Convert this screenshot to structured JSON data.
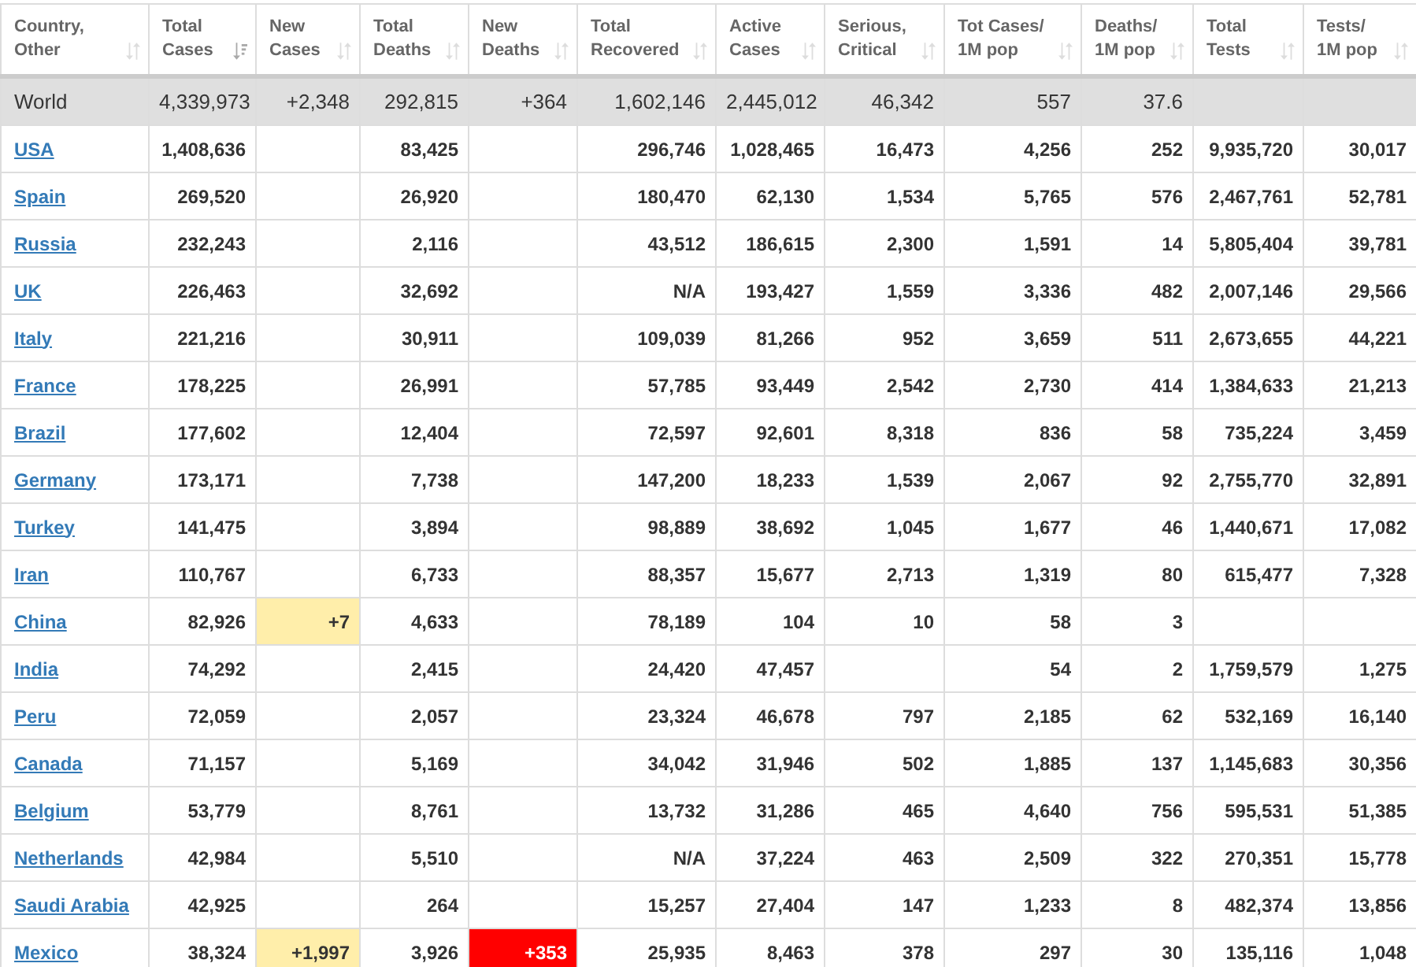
{
  "table": {
    "columns": [
      {
        "label": "Country, Other",
        "kind": "country",
        "sorted": false
      },
      {
        "label": "Total Cases",
        "kind": "number",
        "sorted": true
      },
      {
        "label": "New Cases",
        "kind": "new_cases",
        "sorted": false
      },
      {
        "label": "Total Deaths",
        "kind": "number",
        "sorted": false
      },
      {
        "label": "New Deaths",
        "kind": "new_deaths",
        "sorted": false
      },
      {
        "label": "Total Recovered",
        "kind": "number",
        "sorted": false
      },
      {
        "label": "Active Cases",
        "kind": "number",
        "sorted": false
      },
      {
        "label": "Serious, Critical",
        "kind": "number",
        "sorted": false
      },
      {
        "label": "Tot Cases/ 1M pop",
        "kind": "number",
        "sorted": false
      },
      {
        "label": "Deaths/ 1M pop",
        "kind": "number",
        "sorted": false
      },
      {
        "label": "Total Tests",
        "kind": "number",
        "sorted": false
      },
      {
        "label": "Tests/ 1M pop",
        "kind": "number",
        "sorted": false
      }
    ],
    "rows": [
      {
        "kind": "total",
        "cells": [
          "World",
          "4,339,973",
          "+2,348",
          "292,815",
          "+364",
          "1,602,146",
          "2,445,012",
          "46,342",
          "557",
          "37.6",
          null,
          null
        ]
      },
      {
        "kind": "country",
        "cells": [
          "USA",
          "1,408,636",
          null,
          "83,425",
          null,
          "296,746",
          "1,028,465",
          "16,473",
          "4,256",
          "252",
          "9,935,720",
          "30,017"
        ]
      },
      {
        "kind": "country",
        "cells": [
          "Spain",
          "269,520",
          null,
          "26,920",
          null,
          "180,470",
          "62,130",
          "1,534",
          "5,765",
          "576",
          "2,467,761",
          "52,781"
        ]
      },
      {
        "kind": "country",
        "cells": [
          "Russia",
          "232,243",
          null,
          "2,116",
          null,
          "43,512",
          "186,615",
          "2,300",
          "1,591",
          "14",
          "5,805,404",
          "39,781"
        ]
      },
      {
        "kind": "country",
        "cells": [
          "UK",
          "226,463",
          null,
          "32,692",
          null,
          "N/A",
          "193,427",
          "1,559",
          "3,336",
          "482",
          "2,007,146",
          "29,566"
        ]
      },
      {
        "kind": "country",
        "cells": [
          "Italy",
          "221,216",
          null,
          "30,911",
          null,
          "109,039",
          "81,266",
          "952",
          "3,659",
          "511",
          "2,673,655",
          "44,221"
        ]
      },
      {
        "kind": "country",
        "cells": [
          "France",
          "178,225",
          null,
          "26,991",
          null,
          "57,785",
          "93,449",
          "2,542",
          "2,730",
          "414",
          "1,384,633",
          "21,213"
        ]
      },
      {
        "kind": "country",
        "cells": [
          "Brazil",
          "177,602",
          null,
          "12,404",
          null,
          "72,597",
          "92,601",
          "8,318",
          "836",
          "58",
          "735,224",
          "3,459"
        ]
      },
      {
        "kind": "country",
        "cells": [
          "Germany",
          "173,171",
          null,
          "7,738",
          null,
          "147,200",
          "18,233",
          "1,539",
          "2,067",
          "92",
          "2,755,770",
          "32,891"
        ]
      },
      {
        "kind": "country",
        "cells": [
          "Turkey",
          "141,475",
          null,
          "3,894",
          null,
          "98,889",
          "38,692",
          "1,045",
          "1,677",
          "46",
          "1,440,671",
          "17,082"
        ]
      },
      {
        "kind": "country",
        "cells": [
          "Iran",
          "110,767",
          null,
          "6,733",
          null,
          "88,357",
          "15,677",
          "2,713",
          "1,319",
          "80",
          "615,477",
          "7,328"
        ]
      },
      {
        "kind": "country",
        "cells": [
          "China",
          "82,926",
          "+7",
          "4,633",
          null,
          "78,189",
          "104",
          "10",
          "58",
          "3",
          null,
          null
        ]
      },
      {
        "kind": "country",
        "cells": [
          "India",
          "74,292",
          null,
          "2,415",
          null,
          "24,420",
          "47,457",
          null,
          "54",
          "2",
          "1,759,579",
          "1,275"
        ]
      },
      {
        "kind": "country",
        "cells": [
          "Peru",
          "72,059",
          null,
          "2,057",
          null,
          "23,324",
          "46,678",
          "797",
          "2,185",
          "62",
          "532,169",
          "16,140"
        ]
      },
      {
        "kind": "country",
        "cells": [
          "Canada",
          "71,157",
          null,
          "5,169",
          null,
          "34,042",
          "31,946",
          "502",
          "1,885",
          "137",
          "1,145,683",
          "30,356"
        ]
      },
      {
        "kind": "country",
        "cells": [
          "Belgium",
          "53,779",
          null,
          "8,761",
          null,
          "13,732",
          "31,286",
          "465",
          "4,640",
          "756",
          "595,531",
          "51,385"
        ]
      },
      {
        "kind": "country",
        "cells": [
          "Netherlands",
          "42,984",
          null,
          "5,510",
          null,
          "N/A",
          "37,224",
          "463",
          "2,509",
          "322",
          "270,351",
          "15,778"
        ]
      },
      {
        "kind": "country",
        "cells": [
          "Saudi Arabia",
          "42,925",
          null,
          "264",
          null,
          "15,257",
          "27,404",
          "147",
          "1,233",
          "8",
          "482,374",
          "13,856"
        ]
      },
      {
        "kind": "country",
        "cells": [
          "Mexico",
          "38,324",
          "+1,997",
          "3,926",
          "+353",
          "25,935",
          "8,463",
          "378",
          "297",
          "30",
          "135,116",
          "1,048"
        ]
      }
    ]
  }
}
